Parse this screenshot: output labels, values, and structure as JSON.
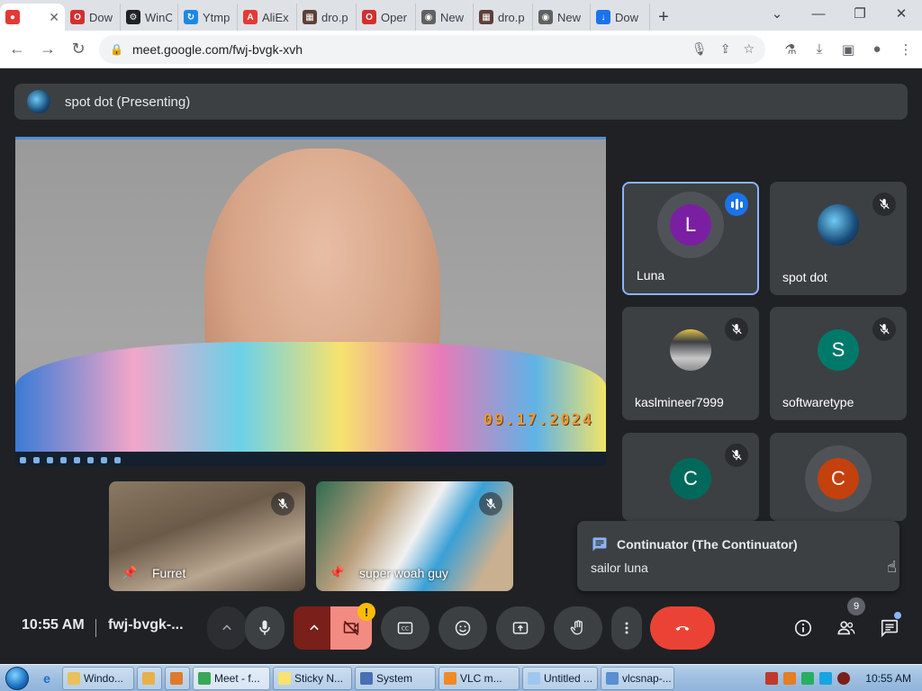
{
  "browser": {
    "tabs": [
      {
        "label": "",
        "active": true,
        "favicon": "meet-recording-icon"
      },
      {
        "label": "Dow",
        "favicon": "opera-icon"
      },
      {
        "label": "WinC",
        "favicon": "gear-icon"
      },
      {
        "label": "Ytmp",
        "favicon": "ytmp-icon"
      },
      {
        "label": "AliEx",
        "favicon": "aliexpress-icon"
      },
      {
        "label": "dro.p",
        "favicon": "image-icon"
      },
      {
        "label": "Oper",
        "favicon": "opera-icon"
      },
      {
        "label": "New",
        "favicon": "chrome-icon"
      },
      {
        "label": "dro.p",
        "favicon": "image-icon"
      },
      {
        "label": "New",
        "favicon": "chrome-icon"
      },
      {
        "label": "Dow",
        "favicon": "download-icon"
      }
    ],
    "new_tab": "+",
    "window_controls": {
      "minimize": "—",
      "maximize": "❐",
      "close": "✕",
      "tablist": "⌄"
    },
    "url": "meet.google.com/fwj-bvgk-xvh"
  },
  "meet": {
    "presenting_label": "spot dot (Presenting)",
    "main_video": {
      "date_stamp": "09.17.2024"
    },
    "tiles": [
      {
        "name": "Luna",
        "initial": "L",
        "color": "#7b1fa2",
        "speaking": true
      },
      {
        "name": "spot dot",
        "initial": "",
        "color": "#1565c0",
        "muted": true
      },
      {
        "name": "kaslmineer7999",
        "initial": "",
        "color": "#6d6d6d",
        "muted": true
      },
      {
        "name": "softwaretype",
        "initial": "S",
        "color": "#00796b",
        "muted": true
      },
      {
        "name": "",
        "initial": "C",
        "color": "#00695c",
        "muted": true
      },
      {
        "name": "",
        "initial": "C",
        "color": "#c4400d",
        "muted": false
      }
    ],
    "video_tiles": [
      {
        "name": "Furret"
      },
      {
        "name": "super woah guy"
      }
    ],
    "chat_popup": {
      "sender": "Continuator (The Continuator)",
      "message": "sailor luna"
    },
    "clock": "10:55 AM",
    "meeting_code": "fwj-bvgk-...",
    "people_count": "9",
    "camera_warning": "!"
  },
  "taskbar": {
    "items": [
      {
        "label": "Windo...",
        "color": "#e8c15a"
      },
      {
        "label": "",
        "color": "#e8b04a"
      },
      {
        "label": "",
        "color": "#e07a2a"
      },
      {
        "label": "Meet - f...",
        "color": "#3aa757",
        "active": true
      },
      {
        "label": "Sticky N...",
        "color": "#f7e36d"
      },
      {
        "label": "System",
        "color": "#4a6fb5"
      },
      {
        "label": "VLC m...",
        "color": "#f08a24"
      },
      {
        "label": "Untitled ...",
        "color": "#9ec7f0"
      },
      {
        "label": "vlcsnap-...",
        "color": "#5a8fd0"
      }
    ],
    "clock": "10:55 AM"
  }
}
